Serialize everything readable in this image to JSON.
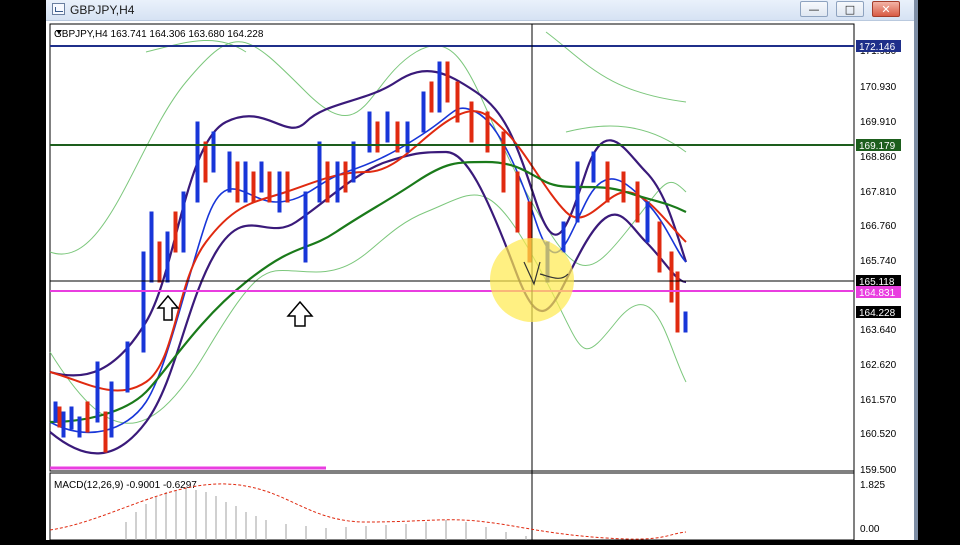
{
  "window": {
    "title": "GBPJPY,H4"
  },
  "chart": {
    "info_line": "GBPJPY,H4  163.741 164.306 163.680 164.228",
    "price_axis": [
      "171.980",
      "170.930",
      "169.910",
      "168.860",
      "167.810",
      "166.760",
      "165.740",
      "163.640",
      "162.620",
      "161.570",
      "160.520",
      "159.500"
    ],
    "price_tags": [
      {
        "label": "172.146",
        "bg": "#1f2f8a",
        "fg": "#ffffff"
      },
      {
        "label": "169.179",
        "bg": "#1d5e1d",
        "fg": "#ffffff"
      },
      {
        "label": "165.118",
        "bg": "#000000",
        "fg": "#ffffff"
      },
      {
        "label": "164.831",
        "bg": "#e93ee0",
        "fg": "#ffffff"
      },
      {
        "label": "164.228",
        "bg": "#000000",
        "fg": "#ffffff"
      }
    ],
    "macd_label": "MACD(12,26,9) -0.9001 -0.6297",
    "macd_axis": [
      "1.825",
      "0.00"
    ],
    "arrow_icons": [
      "up-arrow-icon",
      "up-arrow-icon"
    ],
    "colors": {
      "resistance": "#1f2f8a",
      "support_green": "#1d5e1d",
      "pink": "#e93ee0",
      "ma_red": "#e02a10",
      "ma_blue": "#1836d8",
      "ma_green": "#1a7a1a",
      "envelope_purple": "#3a1a7a",
      "bollinger": "#6ec06e",
      "highlight": "#ffe94d"
    }
  }
}
